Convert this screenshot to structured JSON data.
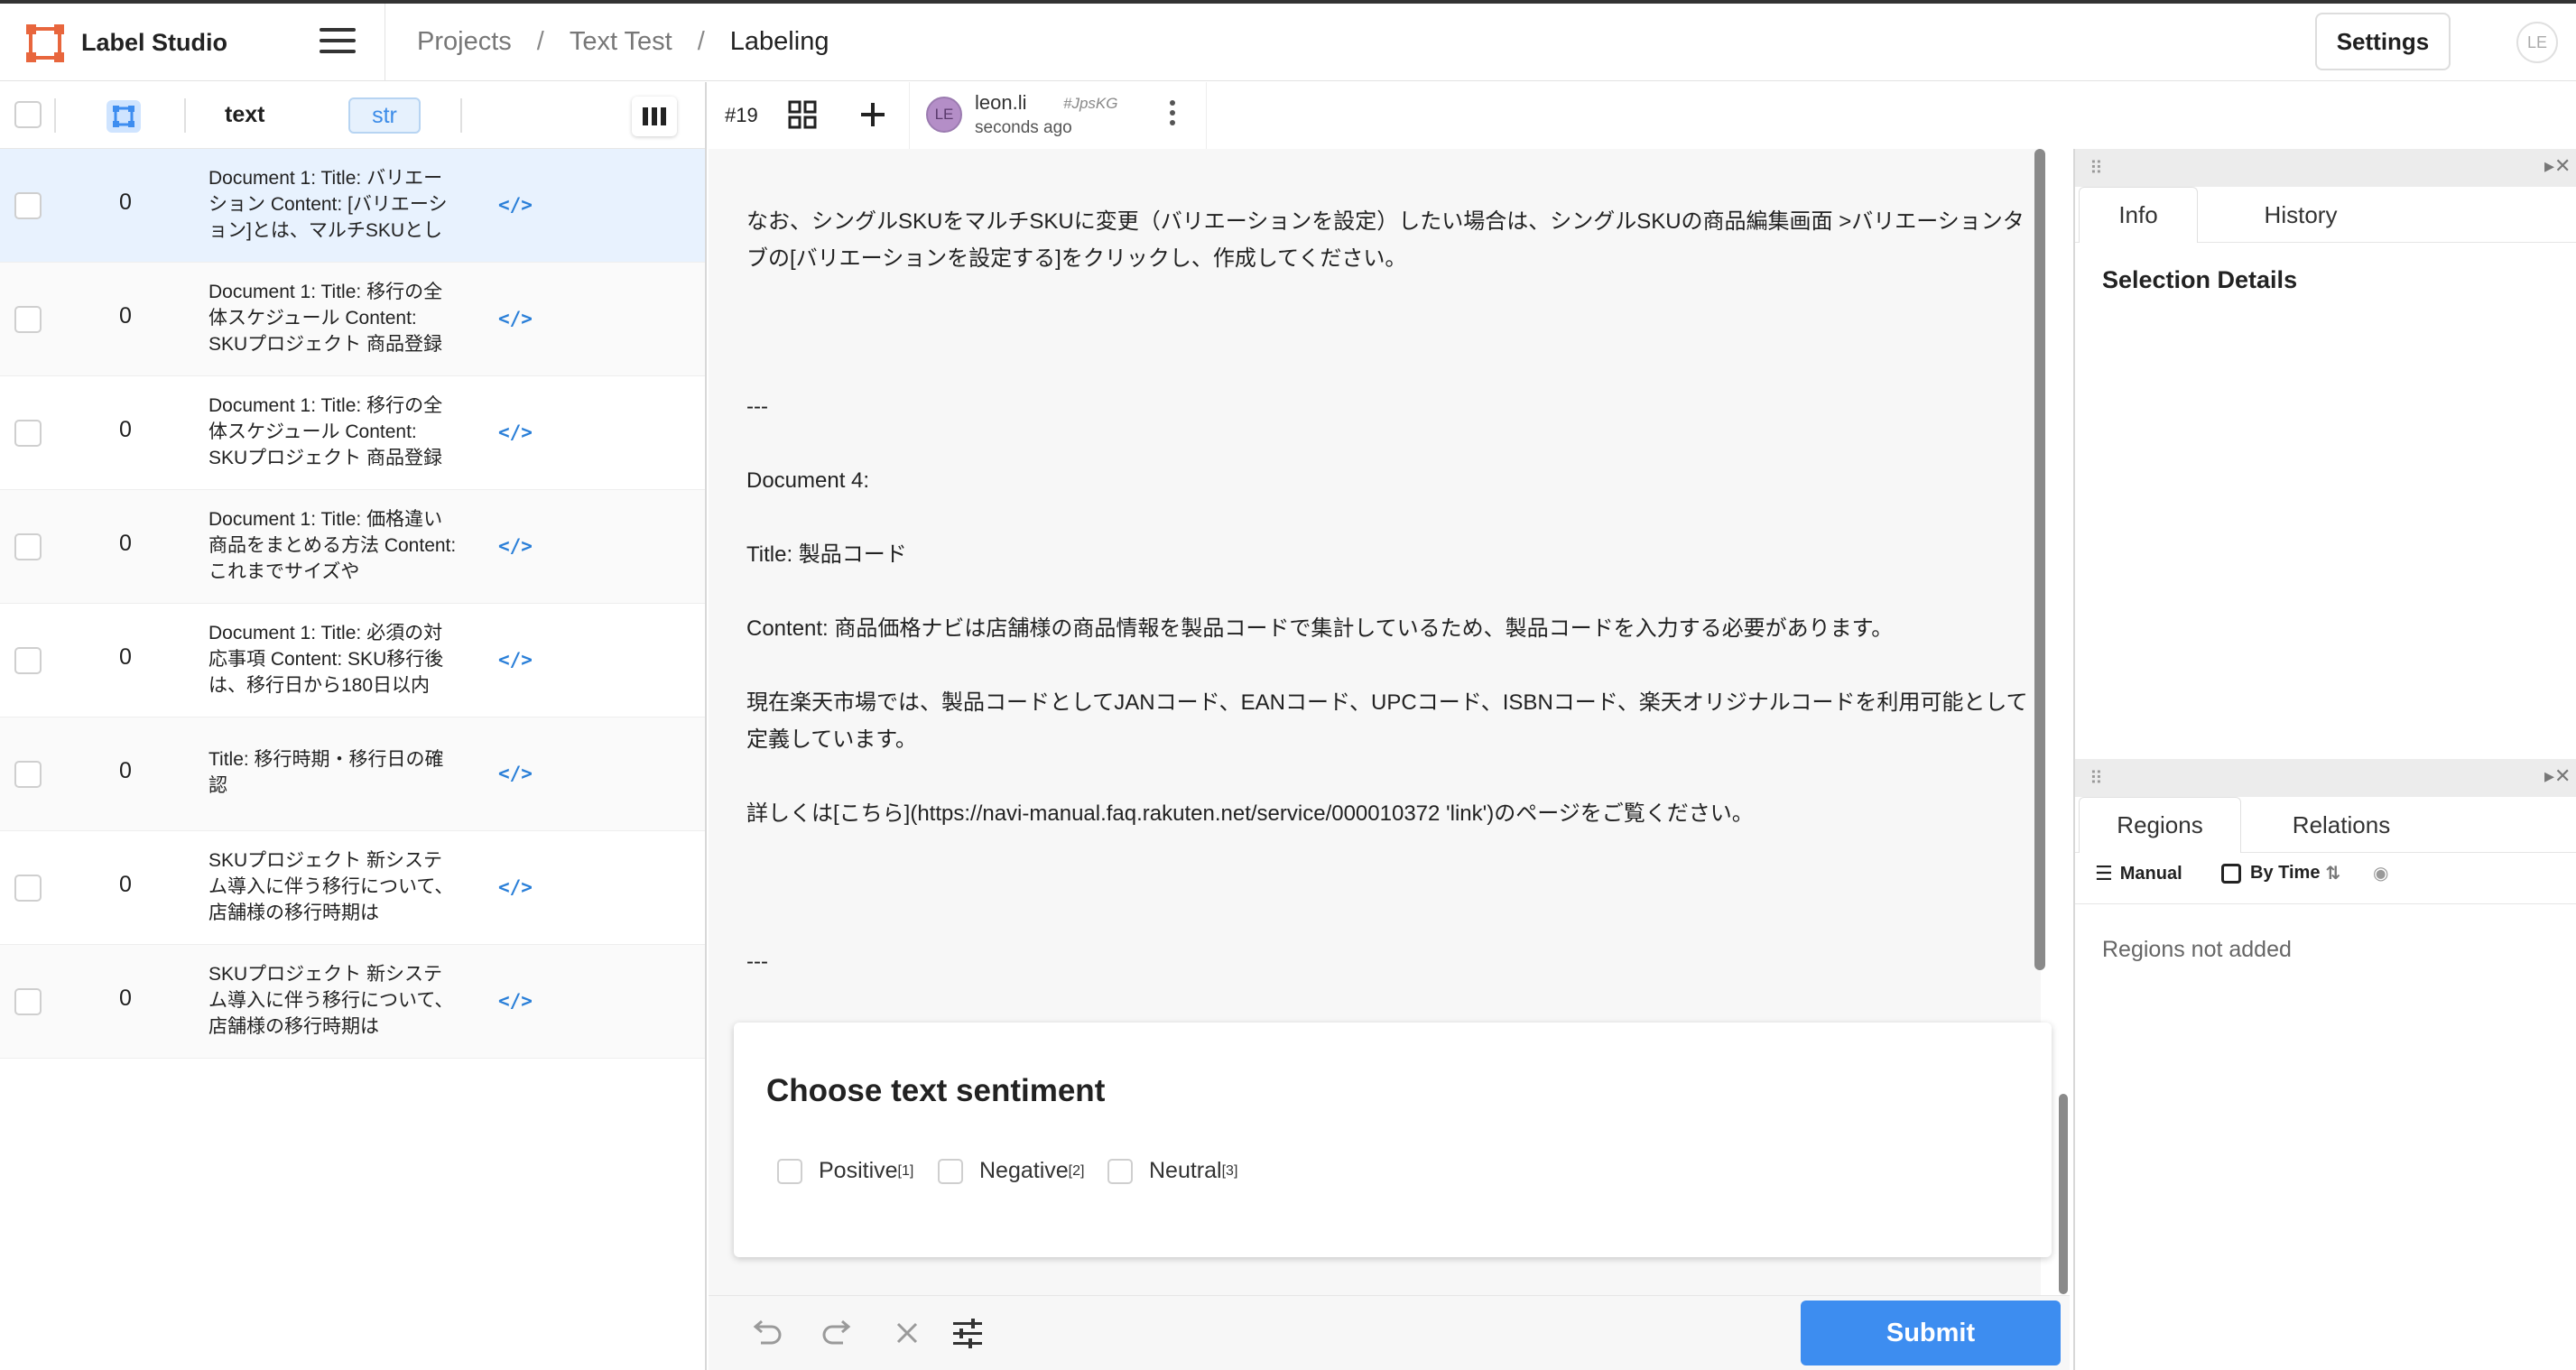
{
  "app": {
    "title": "Label Studio"
  },
  "breadcrumbs": [
    "Projects",
    "Text Test",
    "Labeling"
  ],
  "header": {
    "settings_label": "Settings",
    "user_initials": "LE"
  },
  "table": {
    "columns": {
      "text": "text",
      "type_tag": "str"
    },
    "rows": [
      {
        "count": "0",
        "text": "Document 1: Title: バリエーション Content: [バリエーション]とは、マルチSKUとし",
        "selected": true
      },
      {
        "count": "0",
        "text": "Document 1: Title: 移行の全体スケジュール Content: SKUプロジェクト 商品登録"
      },
      {
        "count": "0",
        "text": "Document 1: Title: 移行の全体スケジュール Content: SKUプロジェクト 商品登録"
      },
      {
        "count": "0",
        "text": "Document 1: Title: 価格違い商品をまとめる方法 Content: これまでサイズや"
      },
      {
        "count": "0",
        "text": "Document 1: Title: 必須の対応事項 Content: SKU移行後は、移行日から180日以内"
      },
      {
        "count": "0",
        "text": "Title: 移行時期・移行日の確認"
      },
      {
        "count": "0",
        "text": "SKUプロジェクト 新システム導入に伴う移行について、店舗様の移行時期は"
      },
      {
        "count": "0",
        "text": "SKUプロジェクト 新システム導入に伴う移行について、店舗様の移行時期は"
      }
    ],
    "code_icon": "</>"
  },
  "task": {
    "id": "#19",
    "annotator": {
      "initials": "LE",
      "name": "leon.li",
      "hash": "#JpsKG",
      "time": "seconds ago"
    }
  },
  "document": {
    "p1": "なお、シングルSKUをマルチSKUに変更（バリエーションを設定）したい場合は、シングルSKUの商品編集画面 >バリエーションタブの[バリエーションを設定する]をクリックし、作成してください。",
    "sep1": "---",
    "doc_label": "Document 4:",
    "title": "Title: 製品コード",
    "content": "Content: 商品価格ナビは店舗様の商品情報を製品コードで集計しているため、製品コードを入力する必要があります。",
    "p2": "現在楽天市場では、製品コードとしてJANコード、EANコード、UPCコード、ISBNコード、楽天オリジナルコードを利用可能として定義しています。",
    "p3": "詳しくは[こちら](https://navi-manual.faq.rakuten.net/service/000010372 'link')のページをご覧ください。",
    "sep2": "---"
  },
  "choices": {
    "title": "Choose text sentiment",
    "options": [
      {
        "label": "Positive",
        "hotkey": "[1]"
      },
      {
        "label": "Negative",
        "hotkey": "[2]"
      },
      {
        "label": "Neutral",
        "hotkey": "[3]"
      }
    ]
  },
  "footer": {
    "submit_label": "Submit"
  },
  "side": {
    "tabs1": [
      "Info",
      "History"
    ],
    "selection_title": "Selection Details",
    "tabs2": [
      "Regions",
      "Relations"
    ],
    "sort_manual": "Manual",
    "sort_by_time": "By Time",
    "empty": "Regions not added"
  },
  "colors": {
    "accent": "#3d8df0",
    "selected_row": "#e8f2fe",
    "code": "#2a7fd8"
  }
}
